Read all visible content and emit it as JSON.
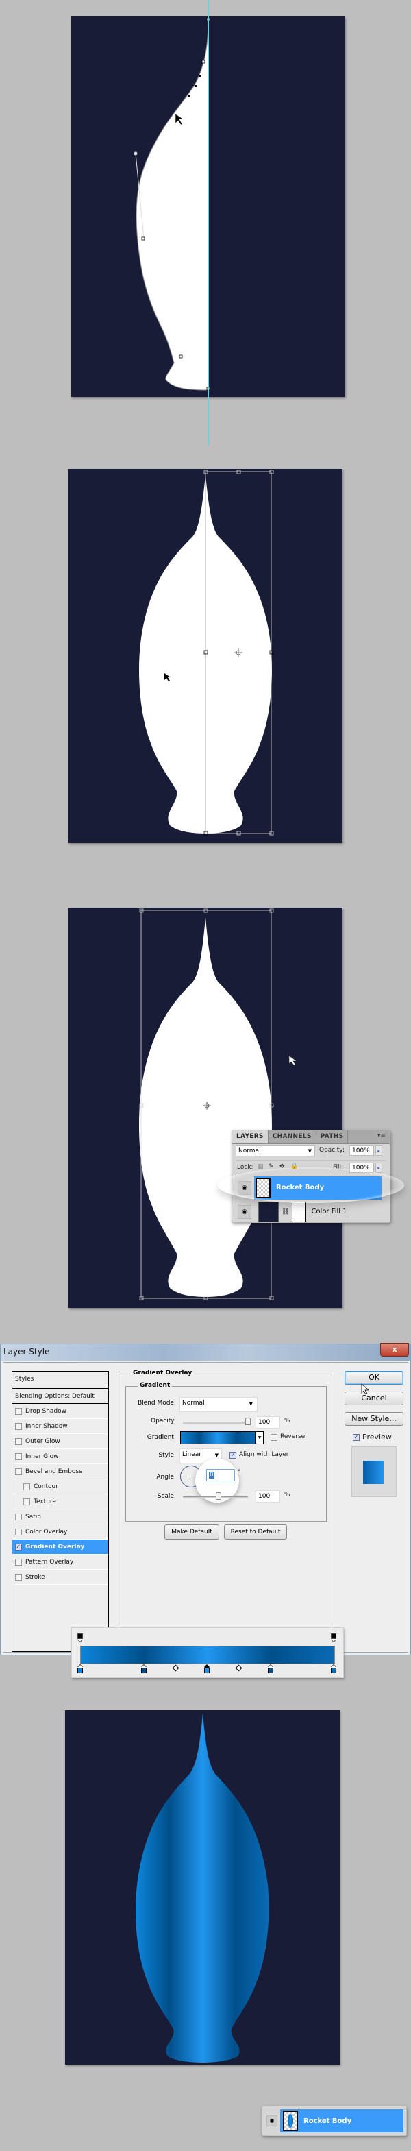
{
  "colors": {
    "workspace_bg": "#bebebe",
    "canvas_bg": "#181c36",
    "guide": "#3fe0f0",
    "selection_blue": "#3a9bfb",
    "gradient_stops": [
      "#0d84d8",
      "#004f8a",
      "#2196ef",
      "#004f8a",
      "#0a6ab4"
    ]
  },
  "step1": {
    "description": "Half rocket path with pen tool anchors and guide"
  },
  "step2": {
    "description": "Mirrored rocket body with free transform box"
  },
  "step3": {
    "layers_panel": {
      "tabs": [
        "LAYERS",
        "CHANNELS",
        "PATHS"
      ],
      "active_tab": "LAYERS",
      "blend_mode": "Normal",
      "opacity_label": "Opacity:",
      "opacity_value": "100%",
      "lock_label": "Lock:",
      "fill_label": "Fill:",
      "fill_value": "100%",
      "layers": [
        {
          "name": "Rocket Body",
          "selected": true,
          "visible": true
        },
        {
          "name": "Color Fill 1",
          "selected": false,
          "visible": true
        }
      ]
    }
  },
  "layer_style_dialog": {
    "title": "Layer Style",
    "close_label": "x",
    "styles_list": [
      {
        "label": "Styles",
        "type": "header"
      },
      {
        "label": "Blending Options: Default",
        "type": "blend"
      },
      {
        "label": "Drop Shadow",
        "checked": false
      },
      {
        "label": "Inner Shadow",
        "checked": false
      },
      {
        "label": "Outer Glow",
        "checked": false
      },
      {
        "label": "Inner Glow",
        "checked": false
      },
      {
        "label": "Bevel and Emboss",
        "checked": false
      },
      {
        "label": "Contour",
        "checked": false,
        "indent": true
      },
      {
        "label": "Texture",
        "checked": false,
        "indent": true
      },
      {
        "label": "Satin",
        "checked": false
      },
      {
        "label": "Color Overlay",
        "checked": false
      },
      {
        "label": "Gradient Overlay",
        "checked": true,
        "active": true
      },
      {
        "label": "Pattern Overlay",
        "checked": false
      },
      {
        "label": "Stroke",
        "checked": false
      }
    ],
    "section_title": "Gradient Overlay",
    "group_title": "Gradient",
    "blend_mode_label": "Blend Mode:",
    "blend_mode_value": "Normal",
    "opacity_label": "Opacity:",
    "opacity_value": "100",
    "opacity_percent": 100,
    "percent_sign": "%",
    "gradient_label": "Gradient:",
    "reverse_label": "Reverse",
    "reverse_checked": false,
    "style_label": "Style:",
    "style_value": "Linear",
    "align_label": "Align with Layer",
    "align_checked": true,
    "angle_label": "Angle:",
    "angle_value": "0",
    "degree_sign": "°",
    "scale_label": "Scale:",
    "scale_value": "100",
    "scale_percent": 100,
    "make_default_label": "Make Default",
    "reset_default_label": "Reset to Default",
    "ok_label": "OK",
    "cancel_label": "Cancel",
    "new_style_label": "New Style...",
    "preview_label": "Preview",
    "preview_checked": true
  },
  "gradient_editor": {
    "opacity_stops": [
      0,
      100
    ],
    "color_stops": [
      {
        "location": 0,
        "color": "#0d84d8"
      },
      {
        "location": 25,
        "color": "#004f8a"
      },
      {
        "location": 50,
        "color": "#2196ef",
        "selected": true
      },
      {
        "location": 75,
        "color": "#004f8a"
      },
      {
        "location": 100,
        "color": "#0a6ab4"
      }
    ],
    "midpoints": [
      37.5,
      62.5
    ]
  },
  "final": {
    "layer_name": "Rocket Body"
  }
}
